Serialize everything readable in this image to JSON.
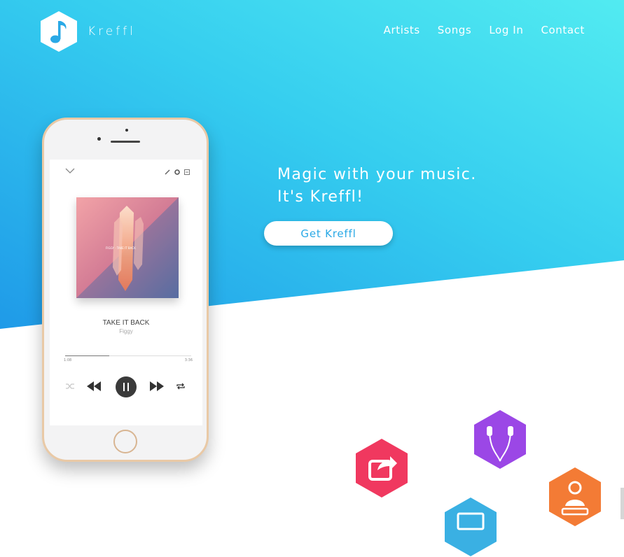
{
  "brand": {
    "name": "Kreffl",
    "logo_icon": "music-note-icon"
  },
  "nav": {
    "items": [
      "Artists",
      "Songs",
      "Log In",
      "Contact"
    ]
  },
  "hero": {
    "headline_line1": "Magic with your music.",
    "headline_line2": "It's Kreffl!",
    "cta_label": "Get Kreffl"
  },
  "player": {
    "song_title": "TAKE IT BACK",
    "artist": "Figgy",
    "time_elapsed": "1:08",
    "time_total": "3:36",
    "progress": 0.35,
    "playing": true
  },
  "feature_icons": [
    {
      "name": "share-icon",
      "color": "#f0385f"
    },
    {
      "name": "headphones-icon",
      "color": "#9b47e6"
    },
    {
      "name": "dj-icon",
      "color": "#f37b35"
    },
    {
      "name": "screen-icon",
      "color": "#3ab0e3"
    }
  ],
  "colors": {
    "gradient_start": "#23a2ea",
    "gradient_end": "#4ee6f0",
    "accent": "#2aa9e6",
    "white": "#ffffff"
  }
}
